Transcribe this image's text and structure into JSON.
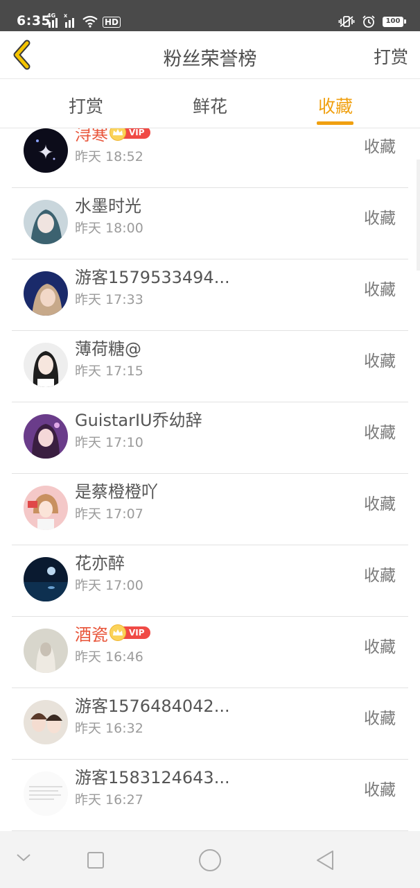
{
  "status_bar": {
    "time": "6:35",
    "net_tags": [
      "4G",
      "x"
    ],
    "hd_label": "HD",
    "battery_level": "100",
    "icons": [
      "signal-icon",
      "wifi-icon",
      "vibrate-icon",
      "alarm-icon",
      "battery-icon"
    ]
  },
  "header": {
    "title": "粉丝荣誉榜",
    "back_icon": "chevron-left-icon",
    "right_action": "打赏",
    "accent_color": "#f0a010"
  },
  "tabs": [
    {
      "label": "打赏",
      "active": false
    },
    {
      "label": "鲜花",
      "active": false
    },
    {
      "label": "收藏",
      "active": true
    }
  ],
  "list": [
    {
      "name": "浔寒",
      "vip": true,
      "vip_label": "VIP",
      "time": "昨天 18:52",
      "action": "收藏"
    },
    {
      "name": "水墨时光",
      "vip": false,
      "time": "昨天 18:00",
      "action": "收藏"
    },
    {
      "name": "游客1579533494...",
      "vip": false,
      "time": "昨天 17:33",
      "action": "收藏"
    },
    {
      "name": "薄荷糖@",
      "vip": false,
      "time": "昨天 17:15",
      "action": "收藏"
    },
    {
      "name": "GuistarIU乔幼辞",
      "vip": false,
      "time": "昨天 17:10",
      "action": "收藏"
    },
    {
      "name": "是蔡橙橙吖",
      "vip": false,
      "time": "昨天 17:07",
      "action": "收藏"
    },
    {
      "name": "花亦醉",
      "vip": false,
      "time": "昨天 17:00",
      "action": "收藏"
    },
    {
      "name": "酒瓷",
      "vip": true,
      "vip_label": "VIP",
      "time": "昨天 16:46",
      "action": "收藏"
    },
    {
      "name": "游客1576484042...",
      "vip": false,
      "time": "昨天 16:32",
      "action": "收藏"
    },
    {
      "name": "游客1583124643...",
      "vip": false,
      "time": "昨天 16:27",
      "action": "收藏"
    }
  ],
  "nav_bar": {
    "buttons": [
      "chevron-down-icon",
      "recents-square-icon",
      "home-circle-icon",
      "back-triangle-icon"
    ]
  }
}
